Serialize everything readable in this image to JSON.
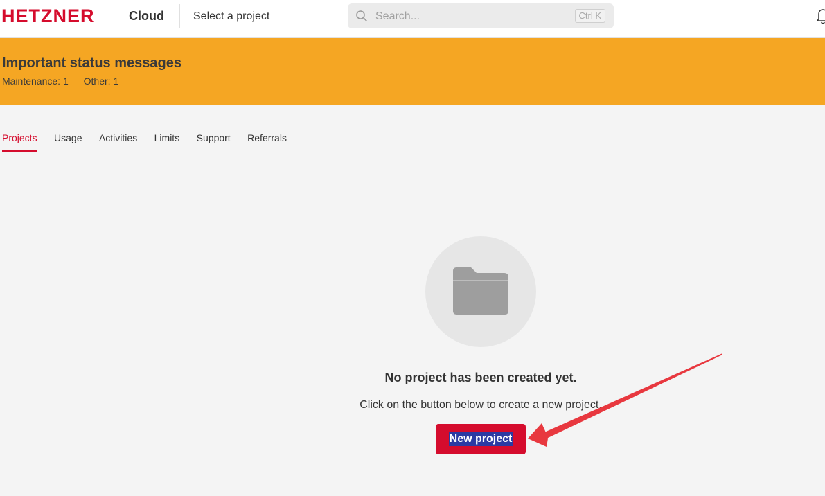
{
  "header": {
    "logo_text": "HETZNER",
    "product": "Cloud",
    "project_selector": "Select a project",
    "search_placeholder": "Search...",
    "search_shortcut": "Ctrl K"
  },
  "banner": {
    "title": "Important status messages",
    "maintenance": "Maintenance: 1",
    "other": "Other: 1"
  },
  "tabs": [
    {
      "label": "Projects",
      "active": true
    },
    {
      "label": "Usage"
    },
    {
      "label": "Activities"
    },
    {
      "label": "Limits"
    },
    {
      "label": "Support"
    },
    {
      "label": "Referrals"
    }
  ],
  "empty_state": {
    "icon": "folder-icon",
    "title": "No project has been created yet.",
    "subtitle": "Click on the button below to create a new project.",
    "button_label": "New project"
  },
  "colors": {
    "brand": "#d50c2d",
    "banner": "#f5a623",
    "background": "#f4f4f4",
    "annotation_arrow": "#e8383f"
  }
}
